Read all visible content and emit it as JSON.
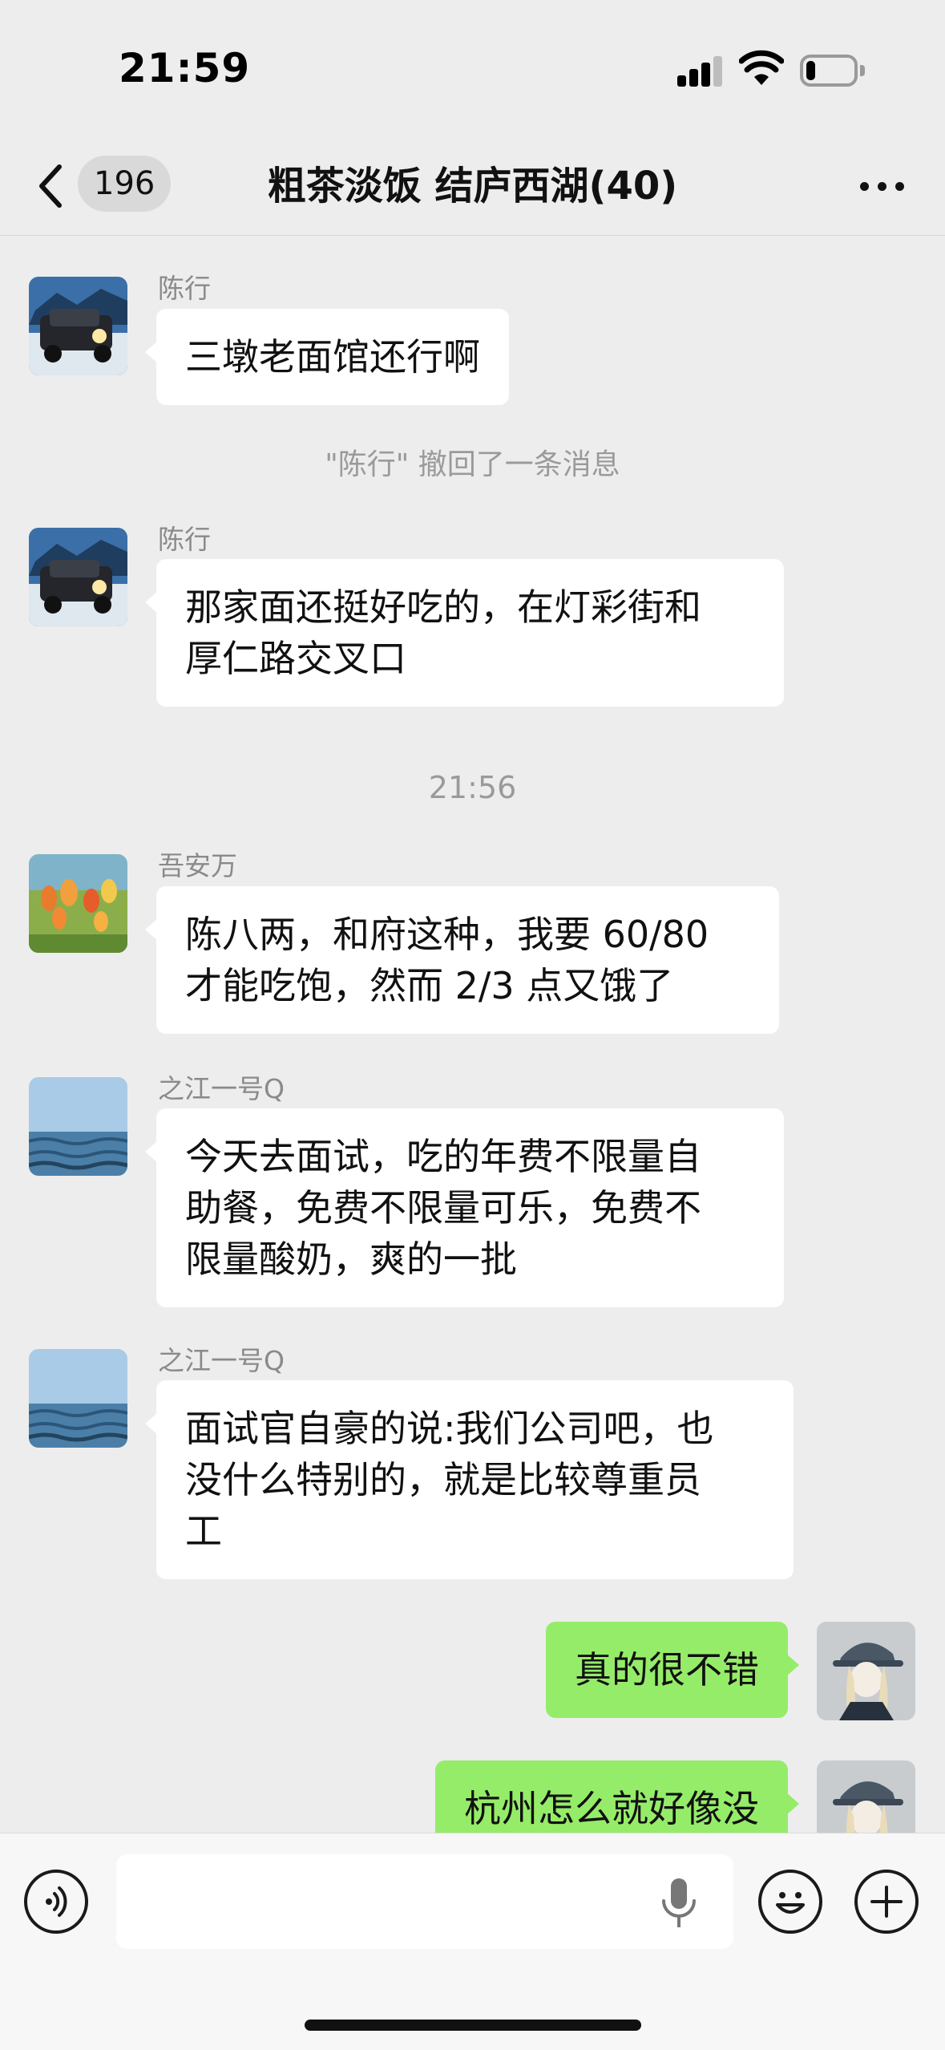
{
  "status_bar": {
    "time": "21:59",
    "battery_level": 0.2
  },
  "nav": {
    "unread_count": "196",
    "title": "粗茶淡饭 结庐西湖(40)"
  },
  "messages": [
    {
      "sender": "陈行",
      "text": "三墩老面馆还行啊"
    },
    {
      "system": "\"陈行\" 撤回了一条消息"
    },
    {
      "sender": "陈行",
      "lines": [
        "那家面还挺好吃的，在灯彩街和",
        "厚仁路交叉口"
      ]
    },
    {
      "timestamp": "21:56"
    },
    {
      "sender": "吾安万",
      "lines": [
        "陈八两，和府这种，我要 60/80",
        "才能吃饱，然而 2/3 点又饿了"
      ]
    },
    {
      "sender": "之江一号Q",
      "lines": [
        "今天去面试，吃的年费不限量自",
        "助餐，免费不限量可乐，免费不",
        "限量酸奶，爽的一批"
      ]
    },
    {
      "sender": "之江一号Q",
      "lines": [
        "面试官自豪的说:我们公司吧，也",
        "没什么特别的，就是比较尊重员",
        "工"
      ]
    },
    {
      "self": true,
      "text": "真的很不错"
    },
    {
      "self": true,
      "text": "杭州怎么就好像没"
    }
  ],
  "input": {
    "placeholder": ""
  },
  "colors": {
    "background": "#ededed",
    "self_bubble": "#95ec69",
    "other_bubble": "#ffffff"
  }
}
